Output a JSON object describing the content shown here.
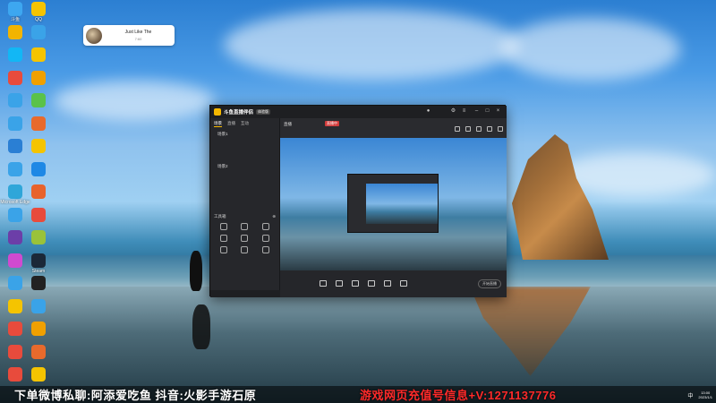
{
  "notification": {
    "title": "Just Like The",
    "subtitle": "7:60"
  },
  "desktop_icons": [
    {
      "label": "斗鱼",
      "color": "#3da7f0"
    },
    {
      "label": "QQ",
      "color": "#f5c400"
    },
    {
      "label": "",
      "color": "#f2b400"
    },
    {
      "label": "",
      "color": "#3aa3e8"
    },
    {
      "label": "",
      "color": "#12b7f5"
    },
    {
      "label": "",
      "color": "#f5c400"
    },
    {
      "label": "",
      "color": "#e84b3c"
    },
    {
      "label": "",
      "color": "#f0a000"
    },
    {
      "label": "",
      "color": "#3aa3e8"
    },
    {
      "label": "",
      "color": "#5ac24a"
    },
    {
      "label": "",
      "color": "#3aa3e8"
    },
    {
      "label": "",
      "color": "#e86a2c"
    },
    {
      "label": "",
      "color": "#2a7fd4"
    },
    {
      "label": "",
      "color": "#f5c400"
    },
    {
      "label": "",
      "color": "#3aa3e8"
    },
    {
      "label": "",
      "color": "#1e88e5"
    },
    {
      "label": "Microsoft Edge",
      "color": "#2fa6d9"
    },
    {
      "label": "",
      "color": "#e8632c"
    },
    {
      "label": "",
      "color": "#3aa3e8"
    },
    {
      "label": "",
      "color": "#e84b3c"
    },
    {
      "label": "",
      "color": "#6c3ea8"
    },
    {
      "label": "",
      "color": "#9ac23a"
    },
    {
      "label": "",
      "color": "#d04ad0"
    },
    {
      "label": "Steam",
      "color": "#1b2838"
    },
    {
      "label": "",
      "color": "#3aa3e8"
    },
    {
      "label": "",
      "color": "#222"
    },
    {
      "label": "",
      "color": "#f5c400"
    },
    {
      "label": "",
      "color": "#3aa3e8"
    },
    {
      "label": "",
      "color": "#e84b3c"
    },
    {
      "label": "",
      "color": "#f0a000"
    },
    {
      "label": "",
      "color": "#e84b3c"
    },
    {
      "label": "",
      "color": "#e86a2c"
    },
    {
      "label": "",
      "color": "#e84b3c"
    },
    {
      "label": "",
      "color": "#f5c400"
    }
  ],
  "app": {
    "title": "斗鱼直播伴侣",
    "version_badge": "体验版",
    "side_tabs": [
      "场景",
      "直播",
      "互动"
    ],
    "scenes": [
      "场景1",
      "",
      "",
      "",
      "场景2",
      "",
      "",
      "",
      "",
      ""
    ],
    "tools_title": "工具箱",
    "tools": [
      "",
      "",
      "",
      "",
      "",
      "",
      "",
      "",
      ""
    ],
    "side_footer": "",
    "live_title": "直播",
    "live_tag": "直播中",
    "live_category": "",
    "toolbar_buttons": [
      "",
      "",
      "",
      "",
      "",
      ""
    ],
    "start_button": "开始直播"
  },
  "banner": {
    "left_text": "下单微博私聊:阿添爱吃鱼 抖音:火影手游石原",
    "right_text": "游戏网页充值号信息+V:1271137776"
  },
  "tray": {
    "lang": "中",
    "time": "13:00",
    "date": "2023/1/1"
  },
  "colors": {
    "accent": "#f5b800",
    "live_red": "#d23b3b",
    "banner_red": "#ff2a2a"
  }
}
